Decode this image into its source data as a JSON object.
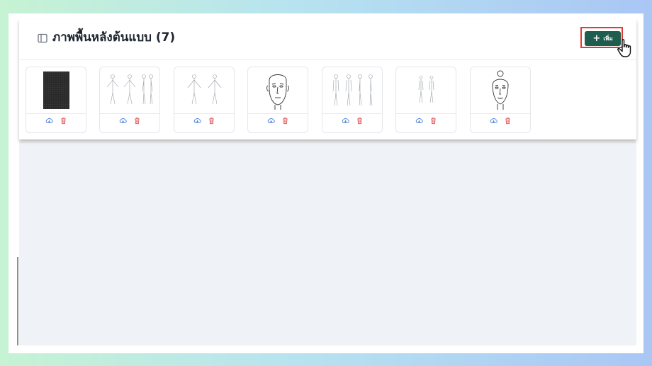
{
  "page": {
    "title": "ภาพพื้นหลังต้นแบบ (7)",
    "add_button_label": "เพิ่ม",
    "add_button_icon": "plus-icon",
    "accent_color": "#1f5e4f",
    "highlight_color": "#e53935"
  },
  "cards": [
    {
      "name": "dark-silhouette-template",
      "download_icon": "cloud-download-icon",
      "delete_icon": "trash-icon"
    },
    {
      "name": "body-front-back-side-template",
      "download_icon": "cloud-download-icon",
      "delete_icon": "trash-icon"
    },
    {
      "name": "body-front-back-template",
      "download_icon": "cloud-download-icon",
      "delete_icon": "trash-icon"
    },
    {
      "name": "male-face-template",
      "download_icon": "cloud-download-icon",
      "delete_icon": "trash-icon"
    },
    {
      "name": "four-view-body-template",
      "download_icon": "cloud-download-icon",
      "delete_icon": "trash-icon"
    },
    {
      "name": "small-body-pair-template",
      "download_icon": "cloud-download-icon",
      "delete_icon": "trash-icon"
    },
    {
      "name": "female-face-template",
      "download_icon": "cloud-download-icon",
      "delete_icon": "trash-icon"
    }
  ]
}
